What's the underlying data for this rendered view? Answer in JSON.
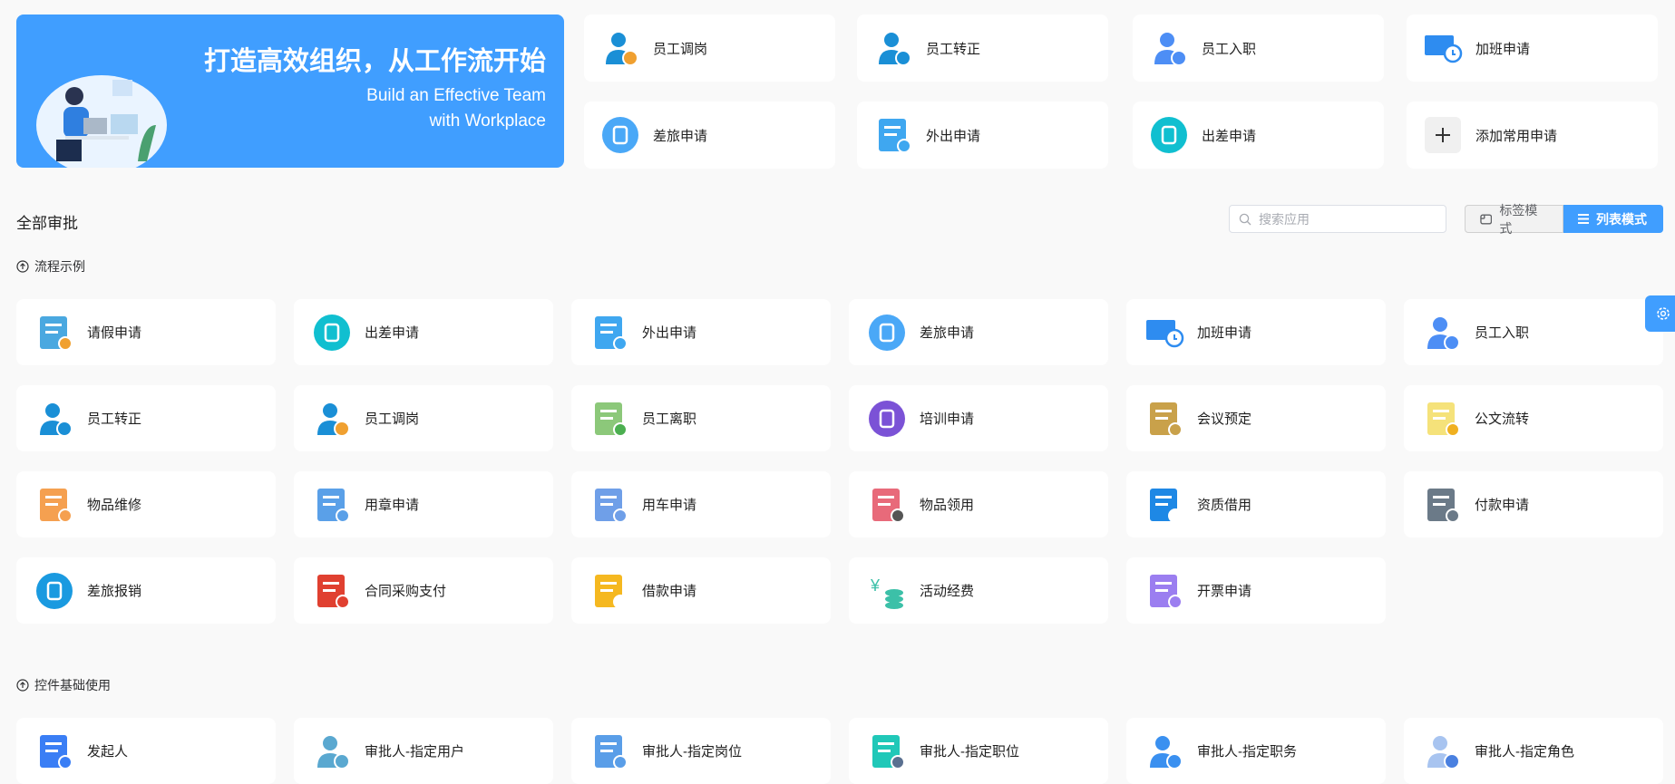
{
  "banner": {
    "title": "打造高效组织，从工作流开始",
    "subtitle_line1": "Build an Effective Team",
    "subtitle_line2": "with Workplace"
  },
  "quick": [
    {
      "label": "员工调岗",
      "icon": "user-transfer-icon",
      "color": "#1a8fd6",
      "accent": "#f0a030"
    },
    {
      "label": "员工转正",
      "icon": "user-regular-icon",
      "color": "#1a8fd6",
      "accent": "#1a8fd6"
    },
    {
      "label": "员工入职",
      "icon": "user-add-icon",
      "color": "#4d8ef5",
      "accent": "#4d8ef5"
    },
    {
      "label": "加班申请",
      "icon": "monitor-clock-icon",
      "color": "#2e8cf0",
      "accent": "#2e8cf0"
    },
    {
      "label": "差旅申请",
      "icon": "luggage-icon",
      "color": "#4aa8f7",
      "accent": "#ffffff"
    },
    {
      "label": "外出申请",
      "icon": "door-exit-icon",
      "color": "#3fa7f0",
      "accent": "#3fa7f0"
    },
    {
      "label": "出差申请",
      "icon": "airplane-icon",
      "color": "#10bfd0",
      "accent": "#ffffff"
    },
    {
      "label": "添加常用申请",
      "icon": "plus-icon",
      "color": "#f0f0f0",
      "accent": "#333333"
    }
  ],
  "main": {
    "title": "全部审批",
    "search_placeholder": "搜索应用",
    "tag_mode": "标签模式",
    "list_mode": "列表模式"
  },
  "groups": [
    {
      "title": "流程示例",
      "items": [
        {
          "label": "请假申请",
          "icon": "leave-icon",
          "color": "#4aa8e0",
          "accent": "#f0a030"
        },
        {
          "label": "出差申请",
          "icon": "airplane-icon",
          "color": "#10bfd0",
          "accent": "#ffffff"
        },
        {
          "label": "外出申请",
          "icon": "door-exit-icon",
          "color": "#3fa7f0",
          "accent": "#3fa7f0"
        },
        {
          "label": "差旅申请",
          "icon": "luggage-icon",
          "color": "#4aa8f7",
          "accent": "#ffffff"
        },
        {
          "label": "加班申请",
          "icon": "monitor-clock-icon",
          "color": "#2e8cf0",
          "accent": "#2e8cf0"
        },
        {
          "label": "员工入职",
          "icon": "user-add-icon",
          "color": "#4d8ef5",
          "accent": "#4d8ef5"
        },
        {
          "label": "员工转正",
          "icon": "user-regular-icon",
          "color": "#1a8fd6",
          "accent": "#1a8fd6"
        },
        {
          "label": "员工调岗",
          "icon": "user-transfer-icon",
          "color": "#1a8fd6",
          "accent": "#f0a030"
        },
        {
          "label": "员工离职",
          "icon": "resign-icon",
          "color": "#8cc87a",
          "accent": "#4caf50"
        },
        {
          "label": "培训申请",
          "icon": "training-icon",
          "color": "#7b52d6",
          "accent": "#ffffff"
        },
        {
          "label": "会议预定",
          "icon": "meeting-icon",
          "color": "#c9a14a",
          "accent": "#c9a14a"
        },
        {
          "label": "公文流转",
          "icon": "document-icon",
          "color": "#f5e27a",
          "accent": "#f0b020"
        },
        {
          "label": "物品维修",
          "icon": "tools-icon",
          "color": "#f5a050",
          "accent": "#f5a050"
        },
        {
          "label": "用章申请",
          "icon": "stamp-icon",
          "color": "#5aa0e8",
          "accent": "#5aa0e8"
        },
        {
          "label": "用车申请",
          "icon": "car-icon",
          "color": "#6f9fe8",
          "accent": "#6f9fe8"
        },
        {
          "label": "物品领用",
          "icon": "box-icon",
          "color": "#e86a7a",
          "accent": "#555555"
        },
        {
          "label": "资质借用",
          "icon": "certificate-icon",
          "color": "#1e88e5",
          "accent": "#ffffff"
        },
        {
          "label": "付款申请",
          "icon": "payment-icon",
          "color": "#6b7a88",
          "accent": "#6b7a88"
        },
        {
          "label": "差旅报销",
          "icon": "reimburse-icon",
          "color": "#1a9ae0",
          "accent": "#ffffff"
        },
        {
          "label": "合同采购支付",
          "icon": "cart-icon",
          "color": "#e04030",
          "accent": "#e04030"
        },
        {
          "label": "借款申请",
          "icon": "loan-icon",
          "color": "#f5b820",
          "accent": "#ffffff"
        },
        {
          "label": "活动经费",
          "icon": "coins-icon",
          "color": "#3cc0a8",
          "accent": "#3cc0a8"
        },
        {
          "label": "开票申请",
          "icon": "invoice-icon",
          "color": "#9b7ef0",
          "accent": "#9b7ef0"
        }
      ]
    },
    {
      "title": "控件基础使用",
      "items": [
        {
          "label": "发起人",
          "icon": "form-edit-icon",
          "color": "#3a7ef5",
          "accent": "#3a7ef5"
        },
        {
          "label": "审批人-指定用户",
          "icon": "user-check-icon",
          "color": "#5aa8d0",
          "accent": "#5aa8d0"
        },
        {
          "label": "审批人-指定岗位",
          "icon": "position-icon",
          "color": "#5a9ee8",
          "accent": "#5a9ee8"
        },
        {
          "label": "审批人-指定职位",
          "icon": "tie-icon",
          "color": "#20c8b8",
          "accent": "#5a7090"
        },
        {
          "label": "审批人-指定职务",
          "icon": "suit-icon",
          "color": "#3a90f0",
          "accent": "#3a90f0"
        },
        {
          "label": "审批人-指定角色",
          "icon": "role-icon",
          "color": "#a8c4f0",
          "accent": "#4a80e0"
        }
      ]
    }
  ]
}
